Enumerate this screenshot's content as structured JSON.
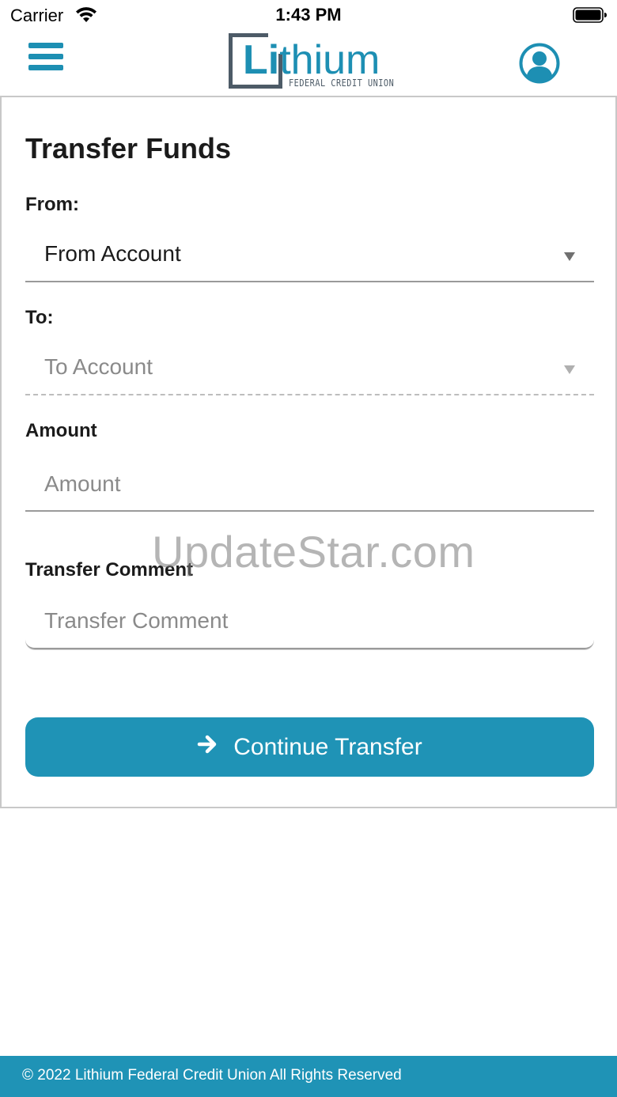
{
  "status_bar": {
    "carrier": "Carrier",
    "time": "1:43 PM"
  },
  "header": {
    "menu_icon": "hamburger-menu-icon",
    "logo": {
      "word_bold": "Li",
      "word_rest": "thium",
      "subtitle": "FEDERAL CREDIT UNION"
    },
    "profile_icon": "user-avatar-icon"
  },
  "form": {
    "title": "Transfer Funds",
    "from": {
      "label": "From:",
      "value": "From Account"
    },
    "to": {
      "label": "To:",
      "value": "To Account"
    },
    "amount": {
      "label": "Amount",
      "placeholder": "Amount"
    },
    "comment": {
      "label": "Transfer Comment",
      "placeholder": "Transfer Comment"
    },
    "continue_button": {
      "label": "Continue Transfer",
      "icon": "arrow-right-icon"
    }
  },
  "watermark": "UpdateStar.com",
  "footer": {
    "text": "© 2022 Lithium Federal Credit Union All Rights Reserved"
  },
  "colors": {
    "accent": "#1f93b6",
    "logo_gray": "#4d5b67"
  }
}
